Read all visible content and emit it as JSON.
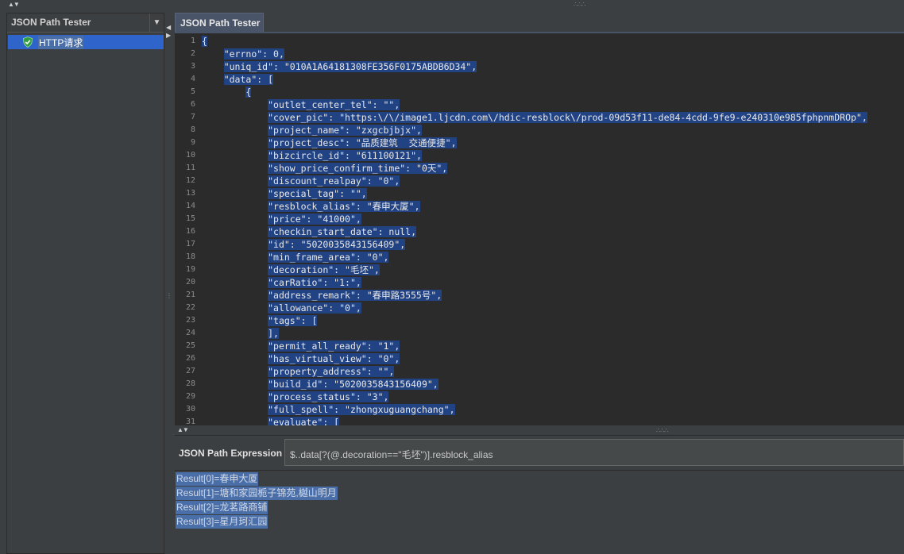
{
  "left_panel": {
    "view_title": "JSON Path Tester",
    "tree_item": "HTTP请求"
  },
  "tab": {
    "title": "JSON Path Tester"
  },
  "editor": {
    "lines": [
      "{",
      "    \"errno\": 0,",
      "    \"uniq_id\": \"010A1A64181308FE356F0175ABDB6D34\",",
      "    \"data\": [",
      "        {",
      "            \"outlet_center_tel\": \"\",",
      "            \"cover_pic\": \"https:\\/\\/image1.ljcdn.com\\/hdic-resblock\\/prod-09d53f11-de84-4cdd-9fe9-e240310e985fphpnmDROp\",",
      "            \"project_name\": \"zxgcbjbjx\",",
      "            \"project_desc\": \"品质建筑  交通便捷\",",
      "            \"bizcircle_id\": \"611100121\",",
      "            \"show_price_confirm_time\": \"0天\",",
      "            \"discount_realpay\": \"0\",",
      "            \"special_tag\": \"\",",
      "            \"resblock_alias\": \"春申大厦\",",
      "            \"price\": \"41000\",",
      "            \"checkin_start_date\": null,",
      "            \"id\": \"5020035843156409\",",
      "            \"min_frame_area\": \"0\",",
      "            \"decoration\": \"毛坯\",",
      "            \"carRatio\": \"1:\",",
      "            \"address_remark\": \"春申路3555号\",",
      "            \"allowance\": \"0\",",
      "            \"tags\": [",
      "            ],",
      "            \"permit_all_ready\": \"1\",",
      "            \"has_virtual_view\": \"0\",",
      "            \"property_address\": \"\",",
      "            \"build_id\": \"5020035843156409\",",
      "            \"process_status\": \"3\",",
      "            \"full_spell\": \"zhongxuguangchang\",",
      "            \"evaluate\": ["
    ]
  },
  "expression": {
    "label": "JSON Path Expression",
    "value": "$..data[?(@.decoration==\"毛坯\")].resblock_alias"
  },
  "results": [
    "Result[0]=春申大厦",
    "Result[1]=塘和家园栀子锦苑,樾山明月",
    "Result[2]=龙茗路商铺",
    "Result[3]=星月珂汇园"
  ]
}
